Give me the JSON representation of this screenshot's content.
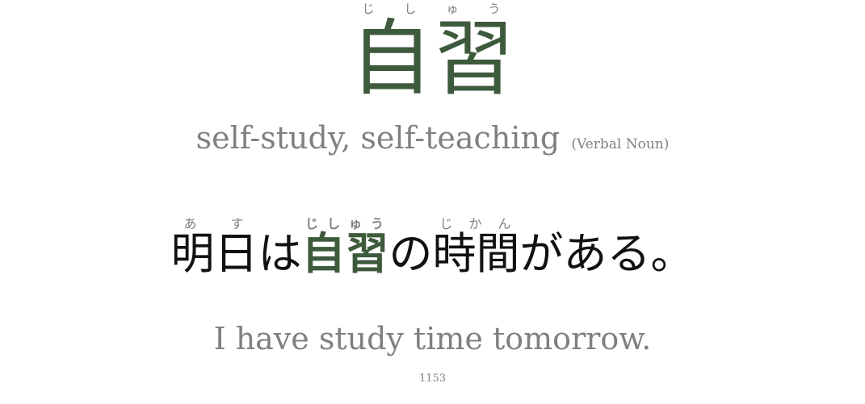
{
  "vocab": {
    "word": "自習",
    "reading": "じしゅう",
    "meaning": "self-study, self-teaching",
    "part_of_speech": "(Verbal Noun)"
  },
  "sentence": {
    "segments": [
      {
        "text": "明日",
        "reading": "あす",
        "highlight": false
      },
      {
        "text": "は",
        "reading": "",
        "highlight": false
      },
      {
        "text": "自習",
        "reading": "じしゅう",
        "highlight": true
      },
      {
        "text": "の",
        "reading": "",
        "highlight": false
      },
      {
        "text": "時間",
        "reading": "じかん",
        "highlight": false
      },
      {
        "text": "がある。",
        "reading": "",
        "highlight": false
      }
    ],
    "translation": "I have study time tomorrow."
  },
  "card": {
    "number": "1153"
  },
  "colors": {
    "accent_green": "#3e5a3c",
    "muted_gray": "#808080",
    "text_black": "#111111",
    "background": "#ffffff"
  }
}
